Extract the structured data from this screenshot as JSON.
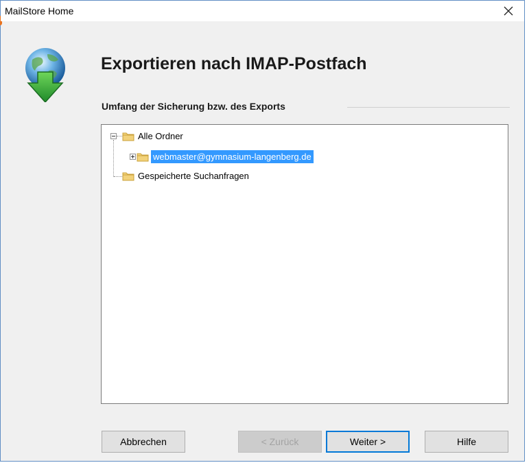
{
  "window": {
    "title": "MailStore Home",
    "close_icon": "close-icon"
  },
  "wizard": {
    "heading": "Exportieren nach IMAP-Postfach",
    "icon": "globe-download-icon",
    "group_label": "Umfang der Sicherung bzw. des Exports"
  },
  "tree": {
    "root": {
      "label": "Alle Ordner",
      "expanded": true,
      "icon": "folder-icon"
    },
    "child": {
      "label": "webmaster@gymnasium-langenberg.de",
      "expanded": false,
      "selected": true,
      "icon": "folder-icon"
    },
    "second_root": {
      "label": "Gespeicherte Suchanfragen",
      "icon": "folder-icon"
    }
  },
  "buttons": {
    "cancel": "Abbrechen",
    "back": "< Zurück",
    "next": "Weiter >",
    "help": "Hilfe"
  },
  "colors": {
    "selection": "#3399ff",
    "default_button_border": "#0078d7",
    "window_background": "#f0f0f0"
  }
}
